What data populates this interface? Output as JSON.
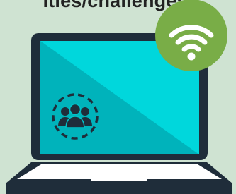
{
  "heading": {
    "text": "ities/challenges."
  },
  "colors": {
    "background": "#cfe3d2",
    "laptop_frame": "#1f2d3a",
    "screen_light": "#00d7dc",
    "screen_dark": "#00b3bb",
    "keyboard_deck": "#ffffff",
    "wifi_badge": "#79ad47",
    "wifi_symbol": "#ffffff",
    "people_icon": "#1f2d3a"
  },
  "icons": {
    "badge": "wifi-icon",
    "screen_center": "people-group-icon",
    "device": "laptop-icon"
  }
}
